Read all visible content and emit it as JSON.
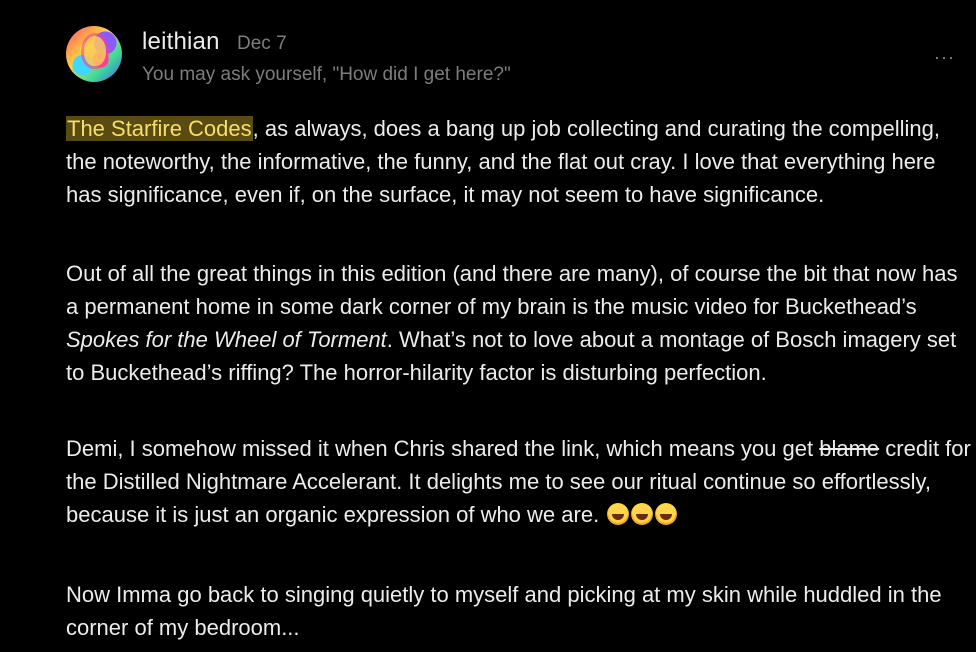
{
  "comment": {
    "author": "leithian",
    "date": "Dec 7",
    "tagline": "You may ask yourself, \"How did I get here?\"",
    "more_label": "···",
    "avatar_icon": "avatar-portrait",
    "paragraph1": {
      "highlight": "The Starfire Codes",
      "rest": ", as always, does a bang up job collecting and curating the compelling, the noteworthy, the informative, the funny, and the flat out cray. I love that everything here has significance, even if, on the surface, it may not seem to have significance."
    },
    "paragraph2": {
      "before": "Out of all the great things in this edition (and there are many), of course the bit that now has a permanent home in some dark corner of my brain is the music video for Buckethead’s ",
      "italic": "Spokes for the Wheel of Torment",
      "after": ". What’s not to love about a montage of Bosch imagery set to Buckethead’s riffing? The horror-hilarity factor is disturbing perfection."
    },
    "paragraph3": {
      "before": "Demi, I somehow missed it when Chris shared the link, which means you get ",
      "struck": "blame",
      "after": " credit for the Distilled Nightmare Accelerant. It delights me to see our ritual continue so effortlessly, because it is just an organic expression of who we are. ",
      "emoji_icon": "rolling-on-floor-laughing-emoji",
      "emoji_count": 3
    },
    "paragraph4": "Now Imma go back to singing quietly to myself and picking at my skin while huddled in the corner of my bedroom..."
  }
}
